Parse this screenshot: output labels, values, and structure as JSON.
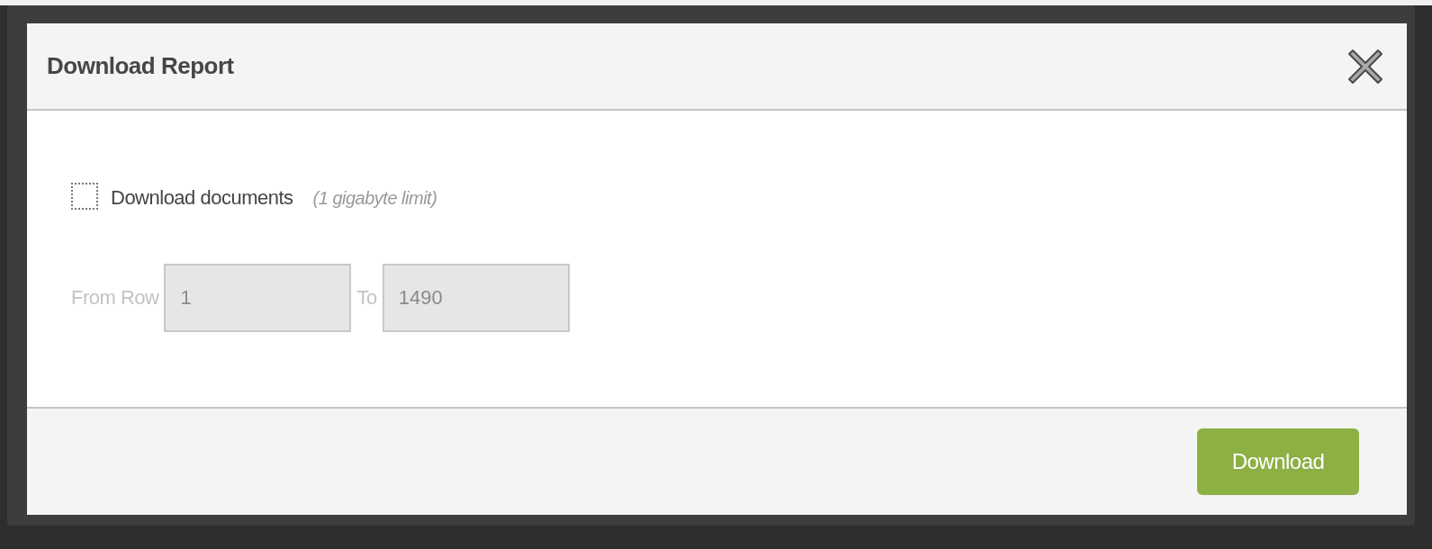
{
  "dialog": {
    "title": "Download Report"
  },
  "option": {
    "label": "Download documents",
    "note": "(1 gigabyte limit)",
    "checked": false
  },
  "range": {
    "disabled": true,
    "from_label": "From Row",
    "from_value": "1",
    "to_label": "To",
    "to_value": "1490"
  },
  "buttons": [
    {
      "label": "Download",
      "kind": "primary"
    }
  ]
}
